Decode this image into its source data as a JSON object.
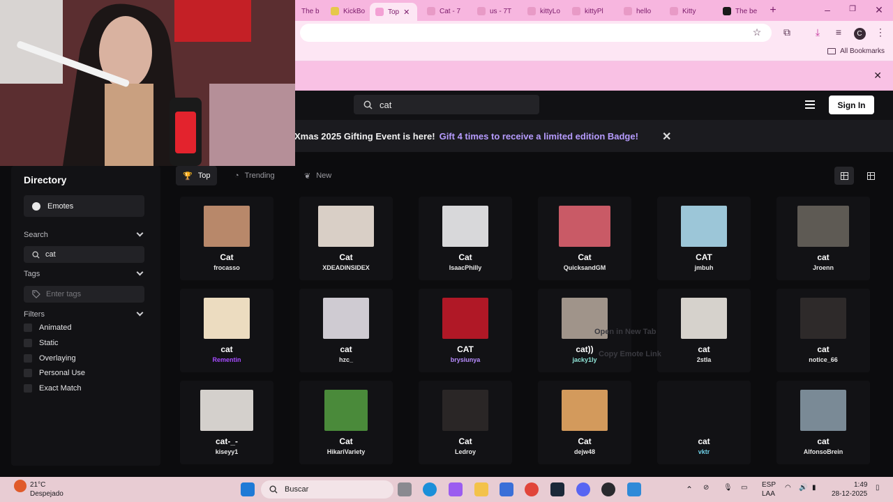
{
  "browser": {
    "tabs": [
      {
        "label": "The be",
        "color": "#f0a0d0"
      },
      {
        "label": "KickBo",
        "color": "#e6c84a"
      },
      {
        "label": "Top",
        "color": "#f7b6df",
        "active": true
      },
      {
        "label": "Cat - 7",
        "color": "#f7b6df"
      },
      {
        "label": "us - 7T",
        "color": "#f7b6df"
      },
      {
        "label": "kittyLo",
        "color": "#f7b6df"
      },
      {
        "label": "kittyPl",
        "color": "#f7b6df"
      },
      {
        "label": "hello",
        "color": "#f7b6df"
      },
      {
        "label": "Kitty",
        "color": "#f7b6df"
      },
      {
        "label": "The be",
        "color": "#1a1a1a"
      }
    ],
    "new_tab": "+",
    "profile_initial": "C",
    "bookmarks_label": "All Bookmarks"
  },
  "site": {
    "search_value": "cat",
    "sign_in": "Sign In",
    "banner_text": "Xmas 2025 Gifting Event is here!",
    "banner_highlight": "Gift 4 times to receive a limited edition Badge!",
    "sidebar": {
      "title": "Directory",
      "emotes_label": "Emotes",
      "search_label": "Search",
      "search_value": "cat",
      "tags_label": "Tags",
      "tags_placeholder": "Enter tags",
      "filters_label": "Filters",
      "filters": [
        "Animated",
        "Static",
        "Overlaying",
        "Personal Use",
        "Exact Match"
      ]
    },
    "sort_tabs": [
      {
        "label": "Top",
        "active": true
      },
      {
        "label": "Trending"
      },
      {
        "label": "New"
      }
    ],
    "context_menu": [
      "Open in New Tab",
      "Copy Emote Link"
    ],
    "emotes": [
      {
        "name": "Cat",
        "author": "frocasso",
        "author_color": "#e8e8e8",
        "thumb": "#b8886a"
      },
      {
        "name": "Cat",
        "author": "XDEADINSIDEX",
        "author_color": "#e8e8e8",
        "thumb": "#d9cfc6"
      },
      {
        "name": "Cat",
        "author": "IsaacPhilly",
        "author_color": "#e8e8e8",
        "thumb": "#d8d8da"
      },
      {
        "name": "Cat",
        "author": "QuicksandGM",
        "author_color": "#e8e8e8",
        "thumb": "#c95a66"
      },
      {
        "name": "CAT",
        "author": "jmbuh",
        "author_color": "#e8e8e8",
        "thumb": "#9cc6d8"
      },
      {
        "name": "cat",
        "author": "Jroenn",
        "author_color": "#e8e8e8",
        "thumb": "#5e5a54"
      },
      {
        "name": "cat",
        "author": "Rementin",
        "author_color": "#a64cff",
        "thumb": "#ecdcc0"
      },
      {
        "name": "cat",
        "author": "hzc_",
        "author_color": "#e8e8e8",
        "thumb": "#cfcbd2"
      },
      {
        "name": "CAT",
        "author": "brysiunya",
        "author_color": "#b78cff",
        "thumb": "#b01826"
      },
      {
        "name": "cat))",
        "author": "jacky1ly",
        "author_color": "#8fe3d6",
        "thumb": "#a0948a"
      },
      {
        "name": "cat",
        "author": "2stla",
        "author_color": "#e8e8e8",
        "thumb": "#d6d2cc"
      },
      {
        "name": "cat",
        "author": "notice_66",
        "author_color": "#e8e8e8",
        "thumb": "#2e2a2a"
      },
      {
        "name": "cat-_-",
        "author": "kiseyy1",
        "author_color": "#e8e8e8",
        "thumb": "#d4d0cc"
      },
      {
        "name": "Cat",
        "author": "HikariVariety",
        "author_color": "#e8e8e8",
        "thumb": "#4a8a3a"
      },
      {
        "name": "Cat",
        "author": "Ledroy",
        "author_color": "#e8e8e8",
        "thumb": "#2a2626"
      },
      {
        "name": "Cat",
        "author": "dejw48",
        "author_color": "#e8e8e8",
        "thumb": "#d39a5c"
      },
      {
        "name": "cat",
        "author": "vktr",
        "author_color": "#6fd1e8",
        "thumb": "#121215"
      },
      {
        "name": "cat",
        "author": "AlfonsoBrein",
        "author_color": "#e8e8e8",
        "thumb": "#7a8a96"
      }
    ]
  },
  "taskbar": {
    "weather_temp": "21°C",
    "weather_desc": "Despejado",
    "search_label": "Buscar",
    "lang_line1": "ESP",
    "lang_line2": "LAA",
    "time": "1:49",
    "date": "28-12-2025"
  }
}
